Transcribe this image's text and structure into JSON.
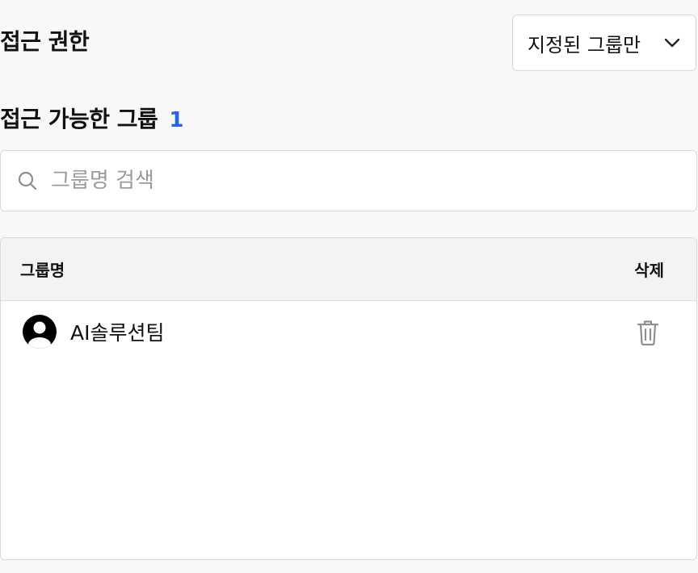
{
  "access": {
    "title": "접근 권한",
    "dropdown_value": "지정된 그룹만",
    "dropdown_icon": "chevron-down-icon"
  },
  "groups": {
    "title": "접근 가능한 그룹",
    "count": "1",
    "count_color": "#2563eb"
  },
  "search": {
    "placeholder": "그룹명 검색",
    "value": "",
    "icon": "search-icon"
  },
  "table": {
    "columns": [
      "그룹명",
      "삭제"
    ],
    "rows": [
      {
        "name": "AI솔루션팀",
        "icon": "user-circle-icon",
        "action_icon": "trash-icon"
      }
    ]
  }
}
